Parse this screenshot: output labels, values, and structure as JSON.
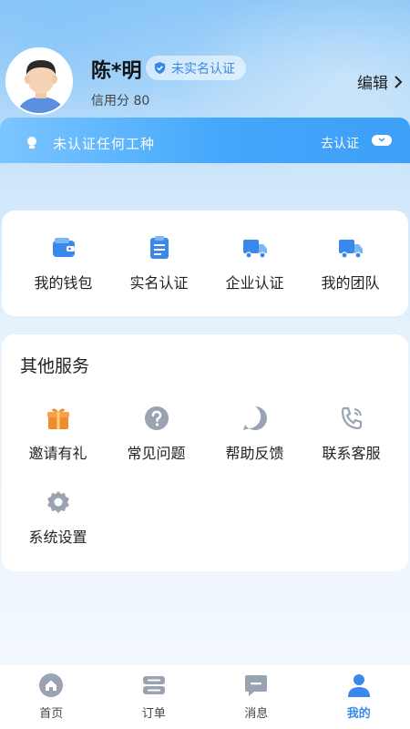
{
  "profile": {
    "name": "陈*明",
    "verify_badge": "未实名认证",
    "credit": "信用分 80",
    "edit_label": "编辑"
  },
  "auth_banner": {
    "text": "未认证任何工种",
    "cta": "去认证"
  },
  "quick_actions": [
    {
      "label": "我的钱包",
      "icon": "wallet-icon"
    },
    {
      "label": "实名认证",
      "icon": "clipboard-icon"
    },
    {
      "label": "企业认证",
      "icon": "truck-icon"
    },
    {
      "label": "我的团队",
      "icon": "truck-icon"
    }
  ],
  "services": {
    "title": "其他服务",
    "items": [
      {
        "label": "邀请有礼",
        "icon": "gift-icon"
      },
      {
        "label": "常见问题",
        "icon": "question-icon"
      },
      {
        "label": "帮助反馈",
        "icon": "feedback-icon"
      },
      {
        "label": "联系客服",
        "icon": "phone-icon"
      },
      {
        "label": "系统设置",
        "icon": "gear-icon"
      }
    ]
  },
  "tabbar": {
    "tabs": [
      {
        "label": "首页",
        "icon": "home-icon"
      },
      {
        "label": "订单",
        "icon": "order-icon"
      },
      {
        "label": "消息",
        "icon": "message-icon"
      },
      {
        "label": "我的",
        "icon": "user-icon",
        "active": true
      }
    ]
  },
  "colors": {
    "accent": "#3a88ea",
    "banner_start": "#7cc5ff",
    "banner_end": "#3d9ff7"
  }
}
